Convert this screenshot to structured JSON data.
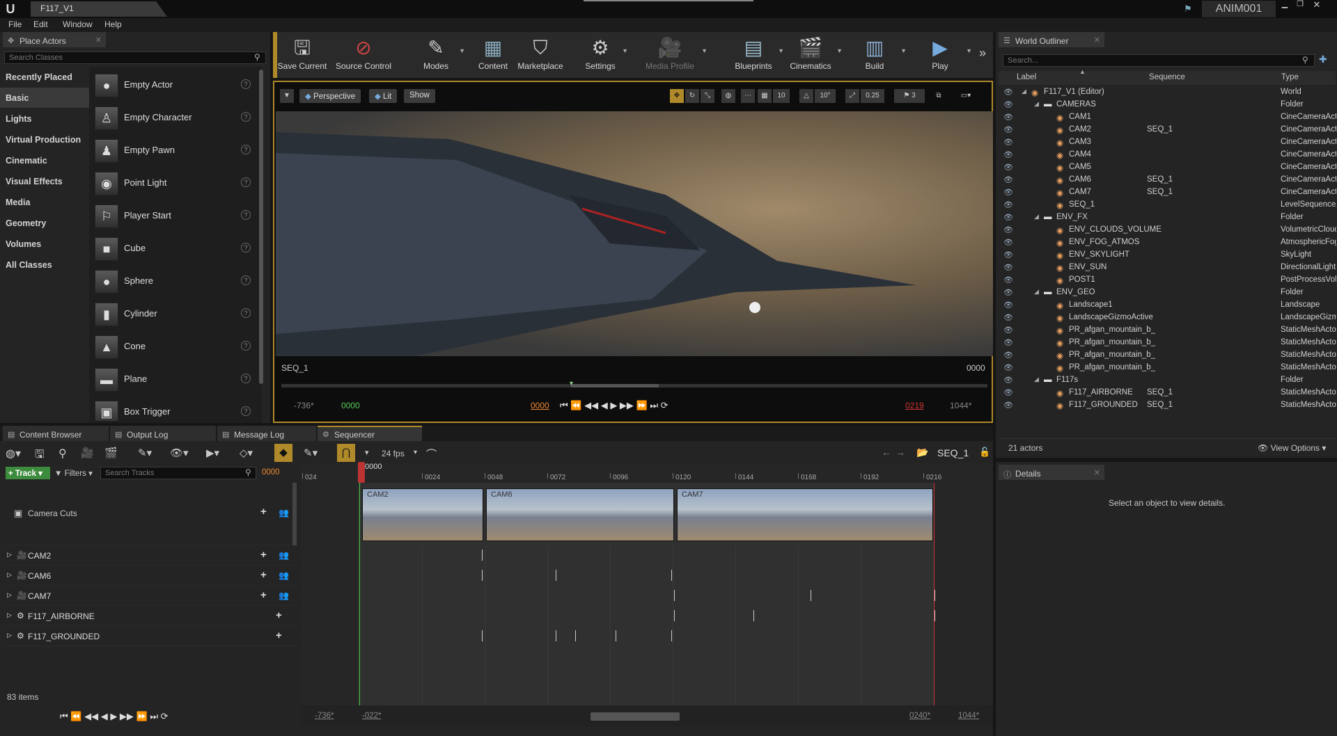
{
  "window": {
    "doc_tab": "F117_V1",
    "project": "ANIM001"
  },
  "menu": [
    "File",
    "Edit",
    "Window",
    "Help"
  ],
  "place_actors": {
    "tab_label": "Place Actors",
    "search_placeholder": "Search Classes",
    "categories": [
      "Recently Placed",
      "Basic",
      "Lights",
      "Virtual Production",
      "Cinematic",
      "Visual Effects",
      "Media",
      "Geometry",
      "Volumes",
      "All Classes"
    ],
    "actors": [
      "Empty Actor",
      "Empty Character",
      "Empty Pawn",
      "Point Light",
      "Player Start",
      "Cube",
      "Sphere",
      "Cylinder",
      "Cone",
      "Plane",
      "Box Trigger"
    ]
  },
  "toolbar": [
    {
      "label": "Save Current",
      "icon": "save-icon"
    },
    {
      "label": "Source Control",
      "icon": "source-control-icon"
    },
    {
      "label": "Modes",
      "icon": "modes-icon"
    },
    {
      "label": "Content",
      "icon": "content-icon"
    },
    {
      "label": "Marketplace",
      "icon": "marketplace-icon"
    },
    {
      "label": "Settings",
      "icon": "settings-icon"
    },
    {
      "label": "Media Profile",
      "icon": "media-profile-icon"
    },
    {
      "label": "Blueprints",
      "icon": "blueprints-icon"
    },
    {
      "label": "Cinematics",
      "icon": "cinematics-icon"
    },
    {
      "label": "Build",
      "icon": "build-icon"
    },
    {
      "label": "Play",
      "icon": "play-icon"
    }
  ],
  "viewport": {
    "perspective": "Perspective",
    "lit": "Lit",
    "show": "Show",
    "grid_snap": "10",
    "rot_snap": "10°",
    "scale_snap": "0.25",
    "cam_speed": "3",
    "seq_name": "SEQ_1",
    "seq_frame": "0000",
    "range_start": "-736*",
    "current": "0000",
    "in_frame": "0000",
    "out_frame": "0219",
    "range_end": "1044*"
  },
  "outliner": {
    "tab_label": "World Outliner",
    "search_placeholder": "Search...",
    "col_label": "Label",
    "col_sequence": "Sequence",
    "col_type": "Type",
    "rows": [
      {
        "label": "F117_V1 (Editor)",
        "seq": "",
        "type": "World"
      },
      {
        "label": "CAMERAS",
        "seq": "",
        "type": "Folder"
      },
      {
        "label": "CAM1",
        "seq": "",
        "type": "CineCameraActor"
      },
      {
        "label": "CAM2",
        "seq": "SEQ_1",
        "type": "CineCameraActor"
      },
      {
        "label": "CAM3",
        "seq": "",
        "type": "CineCameraActor"
      },
      {
        "label": "CAM4",
        "seq": "",
        "type": "CineCameraActor"
      },
      {
        "label": "CAM5",
        "seq": "",
        "type": "CineCameraActor"
      },
      {
        "label": "CAM6",
        "seq": "SEQ_1",
        "type": "CineCameraActor"
      },
      {
        "label": "CAM7",
        "seq": "SEQ_1",
        "type": "CineCameraActor"
      },
      {
        "label": "SEQ_1",
        "seq": "",
        "type": "LevelSequenceActor"
      },
      {
        "label": "ENV_FX",
        "seq": "",
        "type": "Folder"
      },
      {
        "label": "ENV_CLOUDS_VOLUME",
        "seq": "",
        "type": "VolumetricCloud"
      },
      {
        "label": "ENV_FOG_ATMOS",
        "seq": "",
        "type": "AtmosphericFog"
      },
      {
        "label": "ENV_SKYLIGHT",
        "seq": "",
        "type": "SkyLight"
      },
      {
        "label": "ENV_SUN",
        "seq": "",
        "type": "DirectionalLight"
      },
      {
        "label": "POST1",
        "seq": "",
        "type": "PostProcessVolume"
      },
      {
        "label": "ENV_GEO",
        "seq": "",
        "type": "Folder"
      },
      {
        "label": "Landscape1",
        "seq": "",
        "type": "Landscape"
      },
      {
        "label": "LandscapeGizmoActive",
        "seq": "",
        "type": "LandscapeGizmoActor"
      },
      {
        "label": "PR_afgan_mountain_b_",
        "seq": "",
        "type": "StaticMeshActor"
      },
      {
        "label": "PR_afgan_mountain_b_",
        "seq": "",
        "type": "StaticMeshActor"
      },
      {
        "label": "PR_afgan_mountain_b_",
        "seq": "",
        "type": "StaticMeshActor"
      },
      {
        "label": "PR_afgan_mountain_b_",
        "seq": "",
        "type": "StaticMeshActor"
      },
      {
        "label": "F117s",
        "seq": "",
        "type": "Folder"
      },
      {
        "label": "F117_AIRBORNE",
        "seq": "SEQ_1",
        "type": "StaticMeshActor"
      },
      {
        "label": "F117_GROUNDED",
        "seq": "SEQ_1",
        "type": "StaticMeshActor"
      }
    ],
    "actor_count": "21 actors",
    "view_options": "View Options"
  },
  "details": {
    "tab_label": "Details",
    "empty_text": "Select an object to view details."
  },
  "bottom_tabs": [
    "Content Browser",
    "Output Log",
    "Message Log",
    "Sequencer"
  ],
  "sequencer": {
    "fps": "24 fps",
    "seq_name": "SEQ_1",
    "track_btn": "Track",
    "filters": "Filters",
    "search_placeholder": "Search Tracks",
    "current_frame": "0000",
    "playhead_label": "0000",
    "ticks": [
      "024",
      "0024",
      "0048",
      "0072",
      "0096",
      "0120",
      "0144",
      "0168",
      "0192",
      "0216"
    ],
    "camera_cuts": "Camera Cuts",
    "tracks": [
      "CAM2",
      "CAM6",
      "CAM7",
      "F117_AIRBORNE",
      "F117_GROUNDED"
    ],
    "clips": [
      "CAM2",
      "CAM6",
      "CAM7"
    ],
    "items_count": "83 items",
    "range_a": "-736*",
    "range_b": "-022*",
    "range_c": "0240*",
    "range_d": "1044*"
  }
}
